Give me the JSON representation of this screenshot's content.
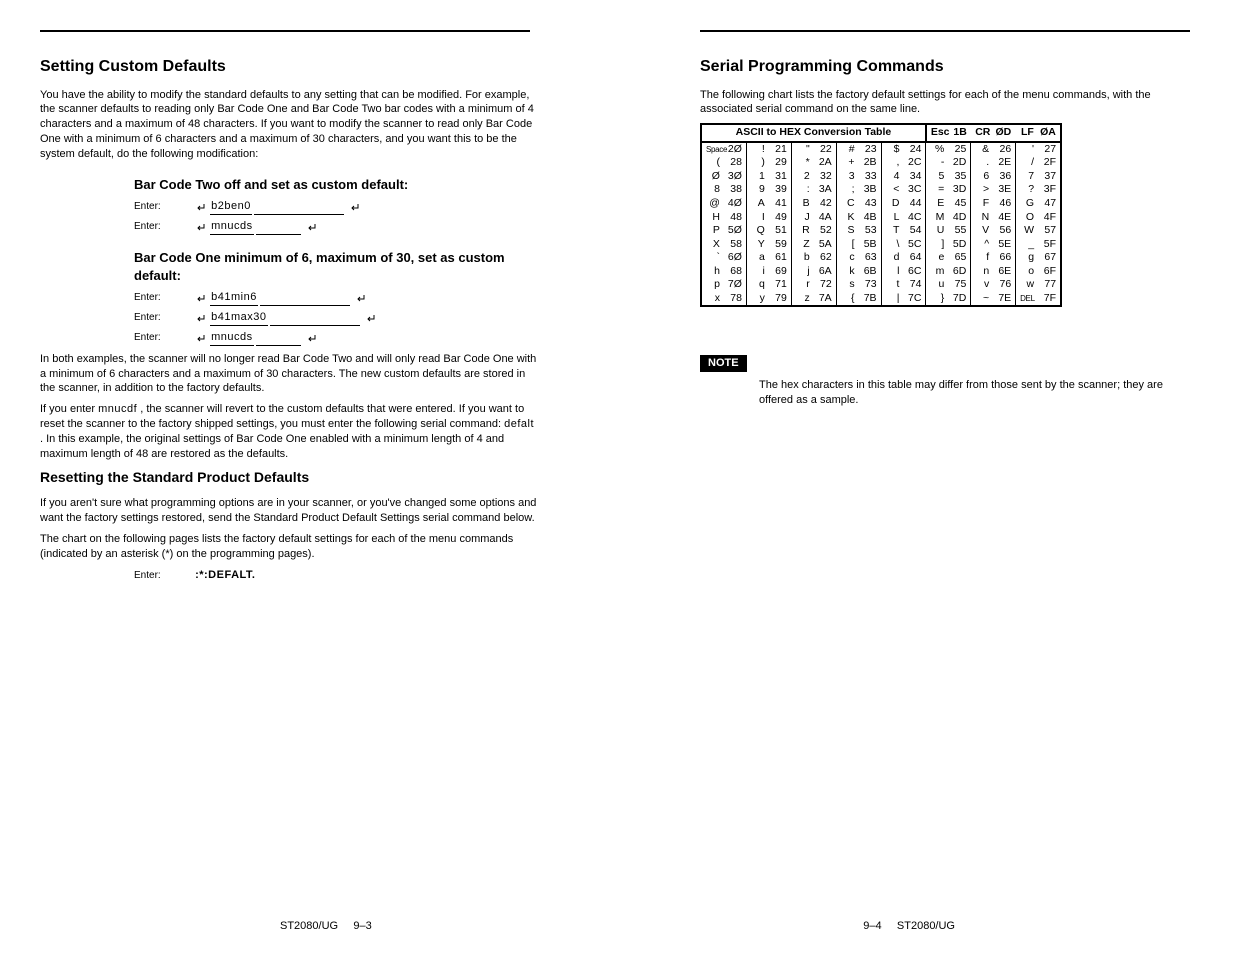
{
  "left": {
    "section_title": "Setting Custom Defaults",
    "p1": "You have the ability to modify the standard defaults to any setting that can be modified.  For example, the scanner defaults to reading only Bar Code One and Bar Code Two bar codes with a minimum of 4 characters and a maximum of 48 characters.  If you want to modify the scanner to read only Bar Code One with a minimum of 6 characters and a maximum of 30 characters, and you want this to be the system default, do the following modification:",
    "box1_heading": "Bar Code Two off and set as custom default:",
    "box2_heading": "Bar Code One minimum of 6, maximum of 30, set as custom default:",
    "cmd_label": "Enter:",
    "box1_1": "b2ben0",
    "box1_2": "mnucds",
    "box2_1": "b41min6",
    "box2_2": "b41max30",
    "box2_3": "mnucds",
    "p2": "In both examples, the scanner will no longer read Bar Code Two and will only read Bar Code One with a minimum of 6 characters and a maximum of 30 characters.  The new custom defaults are stored in the scanner, in addition to the factory defaults.",
    "p3_before": "If you enter ",
    "p3_code": "mnucdf",
    "p3_after": ", the scanner will revert to the custom defaults that were entered.  If you want to reset the scanner to the factory shipped settings, you must enter the following serial command:",
    "p4_code_pre": "defalt",
    "p4_after": ".  In this example, the original settings of Bar Code One enabled with a minimum length of 4 and maximum length of 48 are restored as the defaults.",
    "subhead": "Resetting the Standard Product Defaults",
    "p5": "If you aren't sure what programming options are in your scanner, or you've changed some options and want the factory settings restored, send the Standard Product Default Settings serial command below.",
    "p6": "The chart on the following pages lists the factory default settings for each of the menu commands (indicated by an asterisk (*) on the programming pages).",
    "cmd_factory": ":*:DEFALT.",
    "footpage": "9–3",
    "footbook": "ST2080/UG"
  },
  "right": {
    "section_title": "Serial Programming Commands",
    "p1": "The following chart lists the factory default settings for each of the menu commands, with the associated serial command on the same line.",
    "hex_title": "ASCII to HEX  Conversion Table",
    "hex_extra": [
      {
        "chr": "Esc",
        "hex": "1B"
      },
      {
        "chr": "CR",
        "hex": "ØD"
      },
      {
        "chr": "LF",
        "hex": "ØA"
      }
    ],
    "hex_rows": [
      [
        {
          "chr": "Space",
          "hex": "2Ø",
          "small": true
        },
        {
          "chr": "!",
          "hex": "21"
        },
        {
          "chr": "\"",
          "hex": "22"
        },
        {
          "chr": "#",
          "hex": "23"
        },
        {
          "chr": "$",
          "hex": "24"
        },
        {
          "chr": "%",
          "hex": "25"
        },
        {
          "chr": "&",
          "hex": "26"
        },
        {
          "chr": "'",
          "hex": "27"
        }
      ],
      [
        {
          "chr": "(",
          "hex": "28"
        },
        {
          "chr": ")",
          "hex": "29"
        },
        {
          "chr": "*",
          "hex": "2A"
        },
        {
          "chr": "+",
          "hex": "2B"
        },
        {
          "chr": ",",
          "hex": "2C"
        },
        {
          "chr": "-",
          "hex": "2D"
        },
        {
          "chr": ".",
          "hex": "2E"
        },
        {
          "chr": "/",
          "hex": "2F"
        }
      ],
      [
        {
          "chr": "Ø",
          "hex": "3Ø"
        },
        {
          "chr": "1",
          "hex": "31"
        },
        {
          "chr": "2",
          "hex": "32"
        },
        {
          "chr": "3",
          "hex": "33"
        },
        {
          "chr": "4",
          "hex": "34"
        },
        {
          "chr": "5",
          "hex": "35"
        },
        {
          "chr": "6",
          "hex": "36"
        },
        {
          "chr": "7",
          "hex": "37"
        }
      ],
      [
        {
          "chr": "8",
          "hex": "38"
        },
        {
          "chr": "9",
          "hex": "39"
        },
        {
          "chr": ":",
          "hex": "3A"
        },
        {
          "chr": ";",
          "hex": "3B"
        },
        {
          "chr": "<",
          "hex": "3C"
        },
        {
          "chr": "=",
          "hex": "3D"
        },
        {
          "chr": ">",
          "hex": "3E"
        },
        {
          "chr": "?",
          "hex": "3F"
        }
      ],
      [
        {
          "chr": "@",
          "hex": "4Ø"
        },
        {
          "chr": "A",
          "hex": "41"
        },
        {
          "chr": "B",
          "hex": "42"
        },
        {
          "chr": "C",
          "hex": "43"
        },
        {
          "chr": "D",
          "hex": "44"
        },
        {
          "chr": "E",
          "hex": "45"
        },
        {
          "chr": "F",
          "hex": "46"
        },
        {
          "chr": "G",
          "hex": "47"
        }
      ],
      [
        {
          "chr": "H",
          "hex": "48"
        },
        {
          "chr": "I",
          "hex": "49"
        },
        {
          "chr": "J",
          "hex": "4A"
        },
        {
          "chr": "K",
          "hex": "4B"
        },
        {
          "chr": "L",
          "hex": "4C"
        },
        {
          "chr": "M",
          "hex": "4D"
        },
        {
          "chr": "N",
          "hex": "4E"
        },
        {
          "chr": "O",
          "hex": "4F"
        }
      ],
      [
        {
          "chr": "P",
          "hex": "5Ø"
        },
        {
          "chr": "Q",
          "hex": "51"
        },
        {
          "chr": "R",
          "hex": "52"
        },
        {
          "chr": "S",
          "hex": "53"
        },
        {
          "chr": "T",
          "hex": "54"
        },
        {
          "chr": "U",
          "hex": "55"
        },
        {
          "chr": "V",
          "hex": "56"
        },
        {
          "chr": "W",
          "hex": "57"
        }
      ],
      [
        {
          "chr": "X",
          "hex": "58"
        },
        {
          "chr": "Y",
          "hex": "59"
        },
        {
          "chr": "Z",
          "hex": "5A"
        },
        {
          "chr": "[",
          "hex": "5B"
        },
        {
          "chr": "\\",
          "hex": "5C"
        },
        {
          "chr": "]",
          "hex": "5D"
        },
        {
          "chr": "^",
          "hex": "5E"
        },
        {
          "chr": "_",
          "hex": "5F"
        }
      ],
      [
        {
          "chr": "`",
          "hex": "6Ø"
        },
        {
          "chr": "a",
          "hex": "61"
        },
        {
          "chr": "b",
          "hex": "62"
        },
        {
          "chr": "c",
          "hex": "63"
        },
        {
          "chr": "d",
          "hex": "64"
        },
        {
          "chr": "e",
          "hex": "65"
        },
        {
          "chr": "f",
          "hex": "66"
        },
        {
          "chr": "g",
          "hex": "67"
        }
      ],
      [
        {
          "chr": "h",
          "hex": "68"
        },
        {
          "chr": "i",
          "hex": "69"
        },
        {
          "chr": "j",
          "hex": "6A"
        },
        {
          "chr": "k",
          "hex": "6B"
        },
        {
          "chr": "l",
          "hex": "6C"
        },
        {
          "chr": "m",
          "hex": "6D"
        },
        {
          "chr": "n",
          "hex": "6E"
        },
        {
          "chr": "o",
          "hex": "6F"
        }
      ],
      [
        {
          "chr": "p",
          "hex": "7Ø"
        },
        {
          "chr": "q",
          "hex": "71"
        },
        {
          "chr": "r",
          "hex": "72"
        },
        {
          "chr": "s",
          "hex": "73"
        },
        {
          "chr": "t",
          "hex": "74"
        },
        {
          "chr": "u",
          "hex": "75"
        },
        {
          "chr": "v",
          "hex": "76"
        },
        {
          "chr": "w",
          "hex": "77"
        }
      ],
      [
        {
          "chr": "x",
          "hex": "78"
        },
        {
          "chr": "y",
          "hex": "79"
        },
        {
          "chr": "z",
          "hex": "7A"
        },
        {
          "chr": "{",
          "hex": "7B"
        },
        {
          "chr": "|",
          "hex": "7C"
        },
        {
          "chr": "}",
          "hex": "7D"
        },
        {
          "chr": "~",
          "hex": "7E"
        },
        {
          "chr": "DEL",
          "hex": "7F",
          "small": true
        }
      ]
    ],
    "note_label": "NOTE",
    "note_text": "The hex characters in this table may differ from those sent by the scanner; they are offered as a sample.",
    "footpage": "9–4",
    "footbook": "ST2080/UG"
  }
}
